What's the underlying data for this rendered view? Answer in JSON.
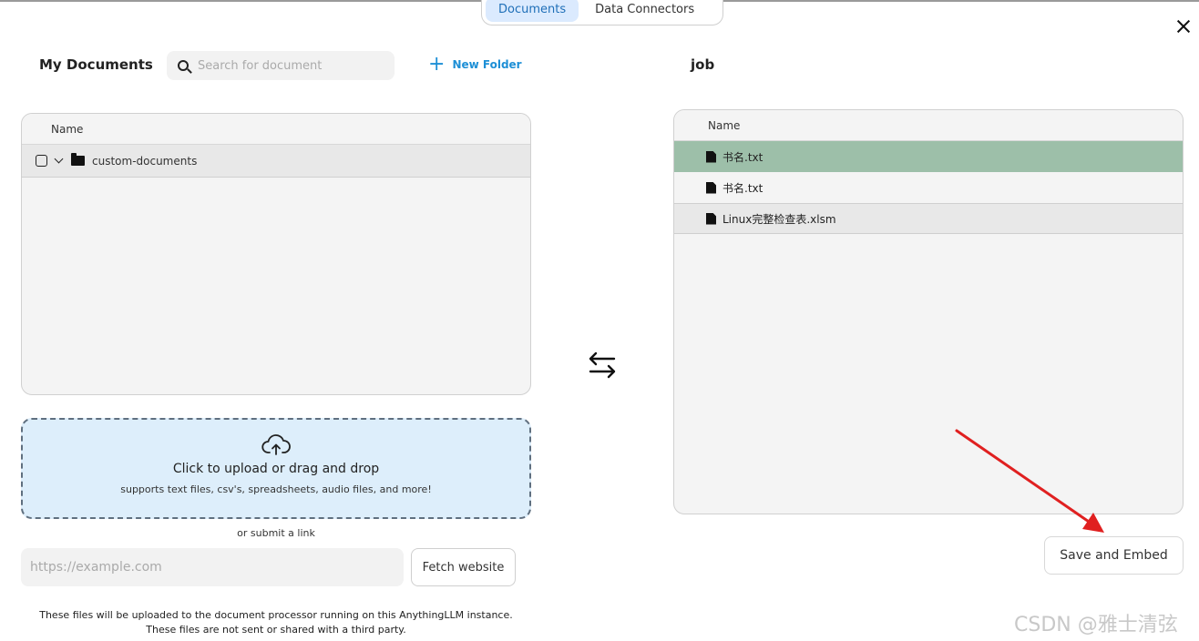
{
  "tabs": [
    {
      "label": "Documents",
      "active": true
    },
    {
      "label": "Data Connectors",
      "active": false
    }
  ],
  "left": {
    "title": "My Documents",
    "search_placeholder": "Search for document",
    "new_folder_label": "New Folder",
    "column_name": "Name",
    "folders": [
      {
        "name": "custom-documents",
        "checked": false,
        "expanded": true
      }
    ]
  },
  "upload": {
    "title": "Click to upload or drag and drop",
    "subtitle": "supports text files, csv's, spreadsheets, audio files, and more!",
    "or_link": "or submit a link",
    "url_placeholder": "https://example.com",
    "fetch_label": "Fetch website",
    "footnote_line1": "These files will be uploaded to the document processor running on this AnythingLLM instance.",
    "footnote_line2": "These files are not sent or shared with a third party."
  },
  "right": {
    "title": "job",
    "column_name": "Name",
    "files": [
      {
        "name": "书名.txt",
        "state": "selected"
      },
      {
        "name": "书名.txt",
        "state": "normal"
      },
      {
        "name": "Linux完整检查表.xlsm",
        "state": "highlighted"
      }
    ],
    "save_label": "Save and Embed"
  },
  "colors": {
    "accent": "#1d8fd6",
    "upload_bg": "#ddeefb",
    "selected_row": "#9dbfa9",
    "annotation_arrow": "#e02020"
  },
  "watermark": "CSDN @雅士清弦",
  "icons": [
    "search-icon",
    "plus-icon",
    "checkbox-icon",
    "chevron-down-icon",
    "folder-icon",
    "cloud-upload-icon",
    "swap-arrows-icon",
    "file-icon",
    "close-icon"
  ]
}
